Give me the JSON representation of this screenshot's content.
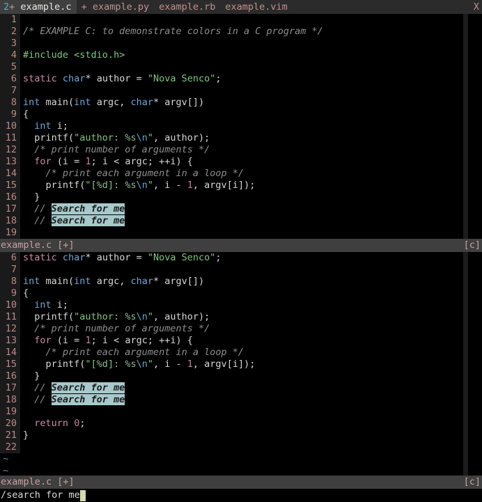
{
  "tabline": {
    "tabs": [
      {
        "num": "2",
        "modified": "+",
        "label": "example.c",
        "active": true
      },
      {
        "num": "",
        "modified": "+",
        "label": "example.py",
        "active": false
      },
      {
        "num": "",
        "modified": "",
        "label": "example.rb",
        "active": false
      },
      {
        "num": "",
        "modified": "",
        "label": "example.vim",
        "active": false
      }
    ],
    "close_label": "X"
  },
  "colors": {
    "tabbar_bg": "#2b2b2b",
    "tab_active_bg": "#3f3f3f",
    "statusline_bg": "#3f3f3f",
    "editor_bg": "#000000",
    "gutter_bg": "#1a1a1a",
    "linenr_fg": "#bd8a8a",
    "search_highlight_bg": "#a7c9cb",
    "colorcolumn_bg": "#1c1c1c",
    "cursor_bg": "#d9d9b0"
  },
  "top_window": {
    "lines": [
      {
        "n": "1",
        "tokens": []
      },
      {
        "n": "2",
        "tokens": [
          {
            "t": "/* EXAMPLE C: to demonstrate colors in a C program */",
            "c": "c-cmt"
          }
        ]
      },
      {
        "n": "3",
        "tokens": []
      },
      {
        "n": "4",
        "tokens": [
          {
            "t": "#include",
            "c": "c-pre"
          },
          {
            "t": " ",
            "c": "c-op"
          },
          {
            "t": "<stdio.h>",
            "c": "c-inc"
          }
        ]
      },
      {
        "n": "5",
        "tokens": []
      },
      {
        "n": "6",
        "tokens": [
          {
            "t": "static",
            "c": "c-kw"
          },
          {
            "t": " ",
            "c": "c-op"
          },
          {
            "t": "char",
            "c": "c-type"
          },
          {
            "t": "* author = ",
            "c": "c-id"
          },
          {
            "t": "\"Nova Senco\"",
            "c": "c-str"
          },
          {
            "t": ";",
            "c": "c-id"
          }
        ]
      },
      {
        "n": "7",
        "tokens": []
      },
      {
        "n": "8",
        "tokens": [
          {
            "t": "int",
            "c": "c-type"
          },
          {
            "t": " main(",
            "c": "c-id"
          },
          {
            "t": "int",
            "c": "c-type"
          },
          {
            "t": " argc, ",
            "c": "c-id"
          },
          {
            "t": "char",
            "c": "c-type"
          },
          {
            "t": "* argv[])",
            "c": "c-id"
          }
        ]
      },
      {
        "n": "9",
        "tokens": [
          {
            "t": "{",
            "c": "c-id"
          }
        ]
      },
      {
        "n": "10",
        "tokens": [
          {
            "t": "  ",
            "c": "c-id"
          },
          {
            "t": "int",
            "c": "c-type"
          },
          {
            "t": " i;",
            "c": "c-id"
          }
        ]
      },
      {
        "n": "11",
        "tokens": [
          {
            "t": "  printf(",
            "c": "c-id"
          },
          {
            "t": "\"author: ",
            "c": "c-str"
          },
          {
            "t": "%s",
            "c": "c-fmt"
          },
          {
            "t": "\\n",
            "c": "c-esc"
          },
          {
            "t": "\"",
            "c": "c-str"
          },
          {
            "t": ", author);",
            "c": "c-id"
          }
        ]
      },
      {
        "n": "12",
        "tokens": [
          {
            "t": "  /* print number of arguments */",
            "c": "c-cmt"
          }
        ]
      },
      {
        "n": "13",
        "tokens": [
          {
            "t": "  ",
            "c": "c-id"
          },
          {
            "t": "for",
            "c": "c-kw"
          },
          {
            "t": " (i = ",
            "c": "c-id"
          },
          {
            "t": "1",
            "c": "c-num"
          },
          {
            "t": "; i < argc; ++i) {",
            "c": "c-id"
          }
        ]
      },
      {
        "n": "14",
        "tokens": [
          {
            "t": "    /* print each argument in a loop */",
            "c": "c-cmt"
          }
        ]
      },
      {
        "n": "15",
        "tokens": [
          {
            "t": "    printf(",
            "c": "c-id"
          },
          {
            "t": "\"[",
            "c": "c-str"
          },
          {
            "t": "%d",
            "c": "c-fmt"
          },
          {
            "t": "]: ",
            "c": "c-str"
          },
          {
            "t": "%s",
            "c": "c-fmt"
          },
          {
            "t": "\\n",
            "c": "c-esc"
          },
          {
            "t": "\"",
            "c": "c-str"
          },
          {
            "t": ", i - ",
            "c": "c-id"
          },
          {
            "t": "1",
            "c": "c-num"
          },
          {
            "t": ", argv[i]);",
            "c": "c-id"
          }
        ]
      },
      {
        "n": "16",
        "tokens": [
          {
            "t": "  }",
            "c": "c-id"
          }
        ]
      },
      {
        "n": "17",
        "tokens": [
          {
            "t": "  // ",
            "c": "c-cmt"
          },
          {
            "t": "Search for me",
            "c": "hl"
          }
        ]
      },
      {
        "n": "18",
        "tokens": [
          {
            "t": "  // ",
            "c": "c-cmt"
          },
          {
            "t": "Search for me",
            "c": "hl"
          }
        ]
      },
      {
        "n": "19",
        "tokens": []
      }
    ],
    "statusline": {
      "left": "example.c [+]",
      "right": "[c]"
    }
  },
  "bottom_window": {
    "lines": [
      {
        "n": "6",
        "tokens": [
          {
            "t": "static",
            "c": "c-kw"
          },
          {
            "t": " ",
            "c": "c-op"
          },
          {
            "t": "char",
            "c": "c-type"
          },
          {
            "t": "* author = ",
            "c": "c-id"
          },
          {
            "t": "\"Nova Senco\"",
            "c": "c-str"
          },
          {
            "t": ";",
            "c": "c-id"
          }
        ]
      },
      {
        "n": "7",
        "tokens": []
      },
      {
        "n": "8",
        "tokens": [
          {
            "t": "int",
            "c": "c-type"
          },
          {
            "t": " main(",
            "c": "c-id"
          },
          {
            "t": "int",
            "c": "c-type"
          },
          {
            "t": " argc, ",
            "c": "c-id"
          },
          {
            "t": "char",
            "c": "c-type"
          },
          {
            "t": "* argv[])",
            "c": "c-id"
          }
        ]
      },
      {
        "n": "9",
        "tokens": [
          {
            "t": "{",
            "c": "c-id"
          }
        ]
      },
      {
        "n": "10",
        "tokens": [
          {
            "t": "  ",
            "c": "c-id"
          },
          {
            "t": "int",
            "c": "c-type"
          },
          {
            "t": " i;",
            "c": "c-id"
          }
        ]
      },
      {
        "n": "11",
        "tokens": [
          {
            "t": "  printf(",
            "c": "c-id"
          },
          {
            "t": "\"author: ",
            "c": "c-str"
          },
          {
            "t": "%s",
            "c": "c-fmt"
          },
          {
            "t": "\\n",
            "c": "c-esc"
          },
          {
            "t": "\"",
            "c": "c-str"
          },
          {
            "t": ", author);",
            "c": "c-id"
          }
        ]
      },
      {
        "n": "12",
        "tokens": [
          {
            "t": "  /* print number of arguments */",
            "c": "c-cmt"
          }
        ]
      },
      {
        "n": "13",
        "tokens": [
          {
            "t": "  ",
            "c": "c-id"
          },
          {
            "t": "for",
            "c": "c-kw"
          },
          {
            "t": " (i = ",
            "c": "c-id"
          },
          {
            "t": "1",
            "c": "c-num"
          },
          {
            "t": "; i < argc; ++i) {",
            "c": "c-id"
          }
        ]
      },
      {
        "n": "14",
        "tokens": [
          {
            "t": "    /* print each argument in a loop */",
            "c": "c-cmt"
          }
        ]
      },
      {
        "n": "15",
        "tokens": [
          {
            "t": "    printf(",
            "c": "c-id"
          },
          {
            "t": "\"[",
            "c": "c-str"
          },
          {
            "t": "%d",
            "c": "c-fmt"
          },
          {
            "t": "]: ",
            "c": "c-str"
          },
          {
            "t": "%s",
            "c": "c-fmt"
          },
          {
            "t": "\\n",
            "c": "c-esc"
          },
          {
            "t": "\"",
            "c": "c-str"
          },
          {
            "t": ", i - ",
            "c": "c-id"
          },
          {
            "t": "1",
            "c": "c-num"
          },
          {
            "t": ", argv[i]);",
            "c": "c-id"
          }
        ]
      },
      {
        "n": "16",
        "tokens": [
          {
            "t": "  }",
            "c": "c-id"
          }
        ]
      },
      {
        "n": "17",
        "tokens": [
          {
            "t": "  // ",
            "c": "c-cmt"
          },
          {
            "t": "Search for me",
            "c": "hl"
          }
        ]
      },
      {
        "n": "18",
        "tokens": [
          {
            "t": "  // ",
            "c": "c-cmt"
          },
          {
            "t": "Search for me",
            "c": "hl"
          }
        ]
      },
      {
        "n": "19",
        "tokens": []
      },
      {
        "n": "20",
        "tokens": [
          {
            "t": "  ",
            "c": "c-id"
          },
          {
            "t": "return",
            "c": "c-kw"
          },
          {
            "t": " ",
            "c": "c-id"
          },
          {
            "t": "0",
            "c": "c-num"
          },
          {
            "t": ";",
            "c": "c-id"
          }
        ]
      },
      {
        "n": "21",
        "tokens": [
          {
            "t": "}",
            "c": "c-id"
          }
        ]
      },
      {
        "n": "22",
        "tokens": []
      }
    ],
    "filler": [
      "~",
      "~"
    ],
    "statusline": {
      "left": "example.c [+]",
      "right": "[c]"
    }
  },
  "cmdline": {
    "text": "/search for me"
  }
}
